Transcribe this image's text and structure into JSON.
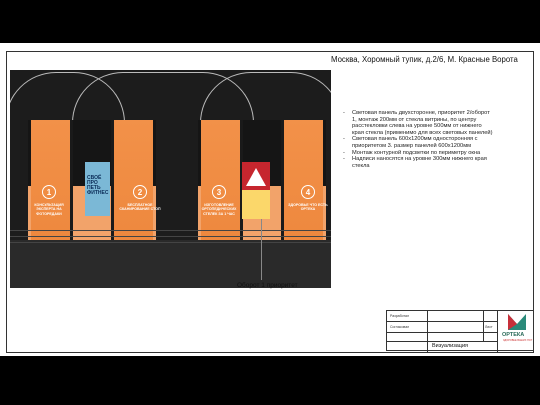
{
  "header": {
    "address": "Москва, Хоромный тупик, д.2/6, М. Красные Ворота"
  },
  "render": {
    "panels": [
      {
        "number": "1",
        "caption": "КОНСУЛЬТАЦИЯ ЭКСПЕРТА НА ФОТОРЕДАКИ"
      },
      {
        "number": "2",
        "caption": "БЕСПЛАТНОЕ СКАНИРОВАНИЕ СТОП"
      },
      {
        "number": "3",
        "caption": "ИЗГОТОВЛЕНИЕ ОРТОПЕДИЧЕСКИХ СТЕЛЕК ЗА 1 ЧАС"
      },
      {
        "number": "4",
        "caption": "ЗДОРОВЬЕ ЧТО ЕСТЬ ОРТЕКА"
      }
    ],
    "poster_left_text": "СВОЁ ПРО ПЕТЬ ФИТНЕС",
    "colors": {
      "orange": "#f0893d",
      "dark": "#1c1c1c"
    }
  },
  "callout": {
    "label": "Оборот 1 приоритет"
  },
  "notes": [
    "Световая панель двухсторонне, приоритет 2/оборот 1, монтаж 200мм от стекла витрины, по центру расстекловки слева на уровне 500мм от нижнего края стекла (применимо для всех световых панелей)",
    "Световая панель 600х1200мм односторонняя с приоритетом 3. размер панелей 600х1200мм",
    "Монтаж контурной подсветки по периметру окна",
    "Надписи наносятся на уровне 300мм нижнего края стекла"
  ],
  "stamp": {
    "row1": "Разработал",
    "row2": "Согласовал",
    "row2_right": "Лист",
    "title": "Визуализация"
  },
  "logo": {
    "name": "ОРТЕКА",
    "tagline": "ЗДОРОВЬЕ ВАШИХ НОГ"
  }
}
